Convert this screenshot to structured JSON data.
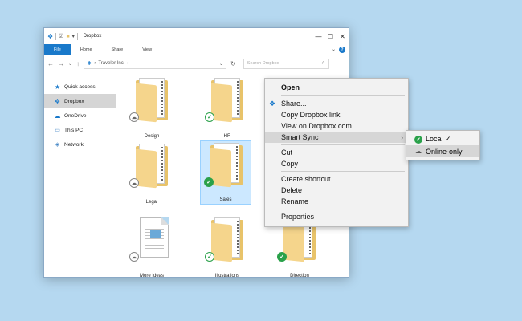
{
  "window": {
    "title": "Dropbox"
  },
  "ribbon": {
    "tabs": [
      "File",
      "Home",
      "Share",
      "View"
    ]
  },
  "address": {
    "path": "Traveler Inc.",
    "search_placeholder": "Search Dropbox"
  },
  "sidebar": {
    "items": [
      {
        "label": "Quick access",
        "icon": "star-icon"
      },
      {
        "label": "Dropbox",
        "icon": "dropbox-icon"
      },
      {
        "label": "OneDrive",
        "icon": "cloud-icon"
      },
      {
        "label": "This PC",
        "icon": "computer-icon"
      },
      {
        "label": "Network",
        "icon": "network-icon"
      }
    ]
  },
  "files": [
    {
      "name": "Design",
      "type": "folder",
      "status": "online-only"
    },
    {
      "name": "HR",
      "type": "folder",
      "status": "local"
    },
    {
      "name": "Legal",
      "type": "folder",
      "status": "online-only"
    },
    {
      "name": "Sales",
      "type": "folder",
      "status": "synced"
    },
    {
      "name": "More Ideas",
      "type": "document",
      "status": "online-only"
    },
    {
      "name": "Illustrations",
      "type": "folder",
      "status": "local"
    },
    {
      "name": "Direction",
      "type": "folder",
      "status": "synced"
    }
  ],
  "context_menu": {
    "open": "Open",
    "share": "Share...",
    "copy_link": "Copy Dropbox link",
    "view_on": "View on Dropbox.com",
    "smart_sync": "Smart Sync",
    "cut": "Cut",
    "copy": "Copy",
    "create_shortcut": "Create shortcut",
    "delete": "Delete",
    "rename": "Rename",
    "properties": "Properties"
  },
  "submenu": {
    "local": "Local ✓",
    "online_only": "Online-only"
  },
  "colors": {
    "accent": "#1979ca",
    "sync_green": "#2aa14a",
    "background": "#b5d8f0"
  }
}
